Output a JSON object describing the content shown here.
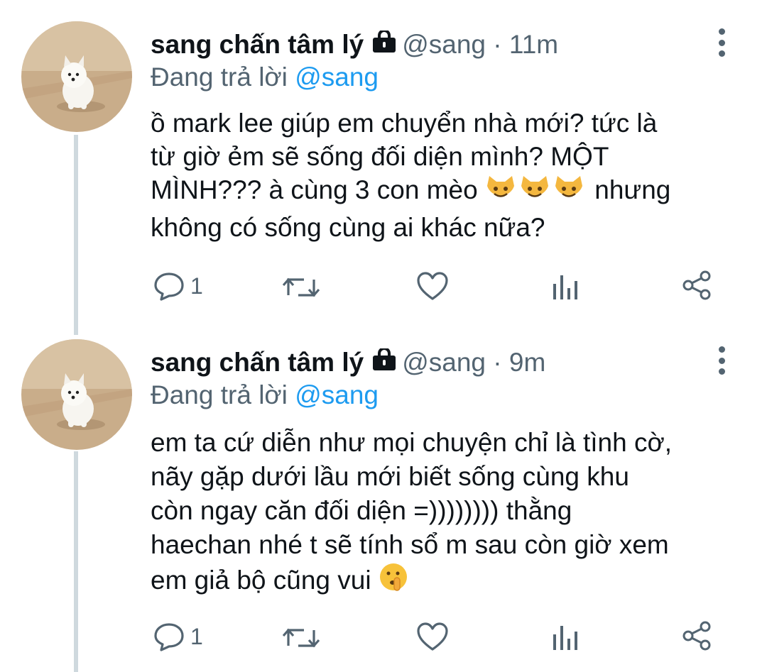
{
  "colors": {
    "text": "#0f1419",
    "meta": "#536471",
    "link": "#1d9bf0",
    "thread_line": "#cfd9de"
  },
  "tweets": [
    {
      "display_name": "sang chấn tâm lý",
      "lock_icon": "lock-icon",
      "handle_time": "@sang · 11m",
      "reply_prefix": "Đang trả lời",
      "reply_handle": "@sang",
      "text_lines": [
        "ồ mark lee giúp em chuyển nhà mới? tức là",
        "từ giờ ẻm sẽ sống đối diện mình? MỘT",
        "MÌNH??? à cùng 3 con mèo",
        "nhưng",
        "không có sống cùng ai khác nữa?"
      ],
      "emoji": "smiling-cat-emoji ×3",
      "reply_count": "1",
      "icons": [
        "reply-icon",
        "retweet-icon",
        "like-icon",
        "analytics-icon",
        "share-icon"
      ]
    },
    {
      "display_name": "sang chấn tâm lý",
      "lock_icon": "lock-icon",
      "handle_time": "@sang · 9m",
      "reply_prefix": "Đang trả lời",
      "reply_handle": "@sang",
      "text_lines": [
        "em ta cứ diễn như mọi chuyện chỉ là tình cờ,",
        "nãy gặp dưới lầu mới biết sống cùng khu",
        "còn ngay căn đối diện =)))))))) thằng",
        "haechan nhé t sẽ tính sổ m sau còn giờ xem",
        "em giả bộ cũng vui"
      ],
      "emoji": "shushing-face-emoji",
      "reply_count": "1",
      "icons": [
        "reply-icon",
        "retweet-icon",
        "like-icon",
        "analytics-icon",
        "share-icon"
      ]
    }
  ]
}
